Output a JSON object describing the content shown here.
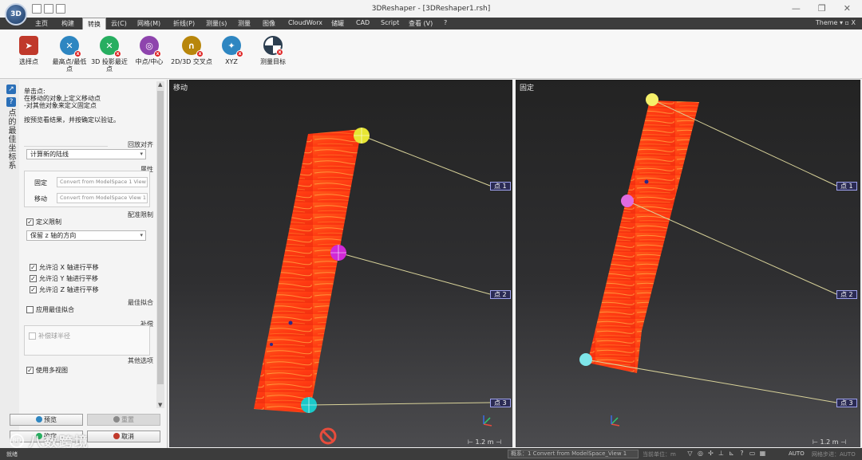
{
  "window": {
    "title": "3DReshaper - [3DReshaper1.rsh]",
    "logo_text": "3D",
    "controls": [
      "—",
      "❐",
      "✕"
    ]
  },
  "menu": {
    "items": [
      "主页",
      "构建",
      "转换",
      "云(C)",
      "网格(M)",
      "折线(P)",
      "测量(s)",
      "测量",
      "图像",
      "CloudWorx",
      "储罐",
      "CAD",
      "Script",
      "查看 (V)",
      "?"
    ],
    "active": "转换",
    "theme_label": "Theme ▾ ▫ X"
  },
  "ribbon": {
    "buttons": [
      {
        "label": "选择点",
        "icon": "pointer-icon",
        "color": "#c0392b"
      },
      {
        "label": "最高点/最低点",
        "icon": "highest-lowest-icon",
        "color": "#2e86c1"
      },
      {
        "label": "3D 投影最近点",
        "icon": "projection-nearest-icon",
        "color": "#27ae60"
      },
      {
        "label": "中点/中心",
        "icon": "midpoint-center-icon",
        "color": "#8e44ad"
      },
      {
        "label": "2D/3D 交叉点",
        "icon": "intersection-icon",
        "color": "#b8860b"
      },
      {
        "label": "XYZ",
        "icon": "xyz-coordinate-icon",
        "color": "#2e86c1"
      },
      {
        "label": "测量目标",
        "icon": "measurement-target-icon",
        "color": "#2c3e50"
      }
    ]
  },
  "left_panel": {
    "vertical_title": "点的最佳坐标系",
    "instructions": {
      "line1": "单击点:",
      "line2": "在移动的对象上定义移动点",
      "line3": "-对其他对象来定义固定点",
      "line4": "按预览看结果，并按确定以验证。"
    },
    "alignment": {
      "section": "回放对齐",
      "dropdown_value": "计算新的陆线"
    },
    "properties": {
      "section": "属性",
      "fixed_label": "固定",
      "fixed_value": "Convert from ModelSpace 1 View 1",
      "moving_label": "移动",
      "moving_value": "Convert from ModelSpace View 1"
    },
    "constraints": {
      "section": "配准限制",
      "define_label": "定义限制",
      "define_checked": true,
      "dropdown_value": "保留 z 轴的方向",
      "options": [
        {
          "label": "允许沿 X 轴进行平移",
          "checked": true
        },
        {
          "label": "允许沿 Y 轴进行平移",
          "checked": true
        },
        {
          "label": "允许沿 Z 轴进行平移",
          "checked": true
        }
      ]
    },
    "best_fit": {
      "section": "最佳拟合",
      "label": "应用最佳拟合",
      "checked": false
    },
    "compensation": {
      "section": "补偿",
      "label": "补偿球半径",
      "checked": false
    },
    "other": {
      "section": "其他选项",
      "label": "使用多视图",
      "checked": true
    },
    "buttons": {
      "preview": "预览",
      "reset": "重置",
      "ok": "确定",
      "cancel": "取消"
    }
  },
  "viewports": {
    "moving": {
      "title": "移动",
      "scale": "1.2 m",
      "labels": [
        "点 1",
        "点 2",
        "点 3"
      ],
      "point_colors": [
        "#e7e633",
        "#d129d6",
        "#1bc9c9"
      ]
    },
    "fixed": {
      "title": "固定",
      "scale": "1.2 m",
      "labels": [
        "点 1",
        "点 2",
        "点 3"
      ],
      "point_colors": [
        "#f5f06a",
        "#e06be0",
        "#7ee6ea"
      ]
    }
  },
  "statusbar": {
    "left": "就绪",
    "object_info": "概系：1 Convert from ModelSpace_View 1",
    "unit": "当前单位：m",
    "auto": "AUTO",
    "step": "网格步进：AUTO"
  },
  "watermark": {
    "logo": "BD",
    "text": "八数跨境"
  }
}
